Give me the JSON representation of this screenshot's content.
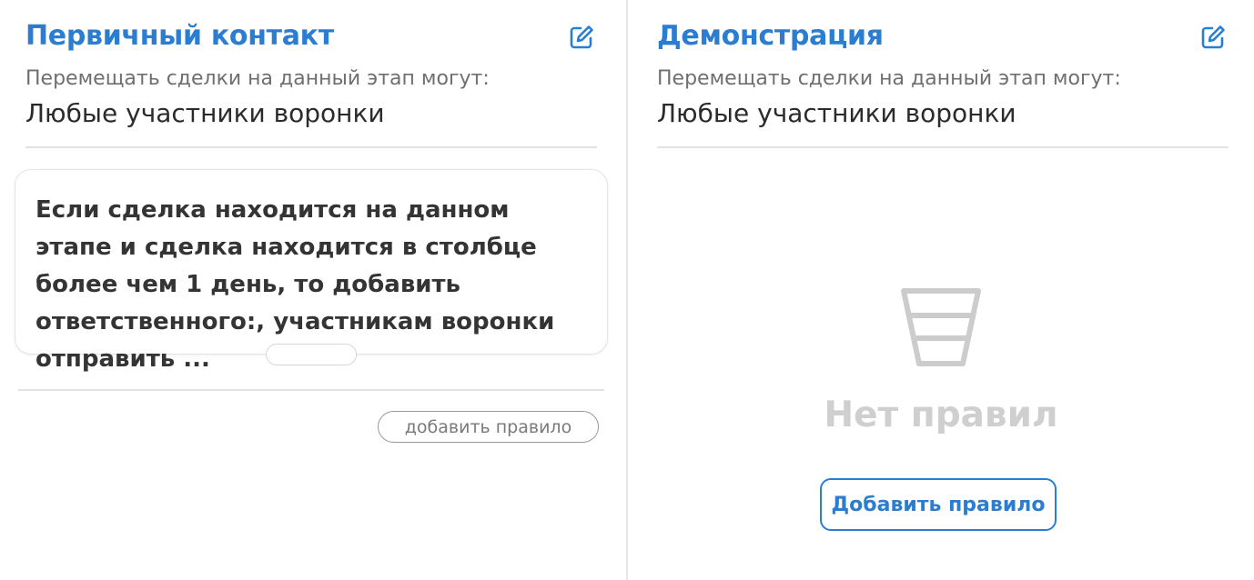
{
  "stages": [
    {
      "title": "Первичный контакт",
      "permission_label": "Перемещать сделки на данный этап могут:",
      "permission_value": "Любые участники воронки",
      "edit_icon": "pencil-edit-icon",
      "rules": [
        {
          "text": "Если сделка находится на данном этапе и сделка находится в столбце более чем 1 день, то добавить ответственного:, участникам воронки отправить ..."
        }
      ],
      "add_rule_label": "добавить правило"
    },
    {
      "title": "Демонстрация",
      "permission_label": "Перемещать сделки на данный этап могут:",
      "permission_value": "Любые участники воронки",
      "edit_icon": "pencil-edit-icon",
      "rules": [],
      "empty_icon": "funnel-icon",
      "empty_text": "Нет правил",
      "add_rule_label": "Добавить правило"
    }
  ],
  "colors": {
    "accent": "#2a7dd1",
    "text_primary": "#2b2b2b",
    "text_secondary": "#6f6f6f",
    "empty_gray": "#cfcfcf",
    "divider": "#e3e3e3"
  }
}
